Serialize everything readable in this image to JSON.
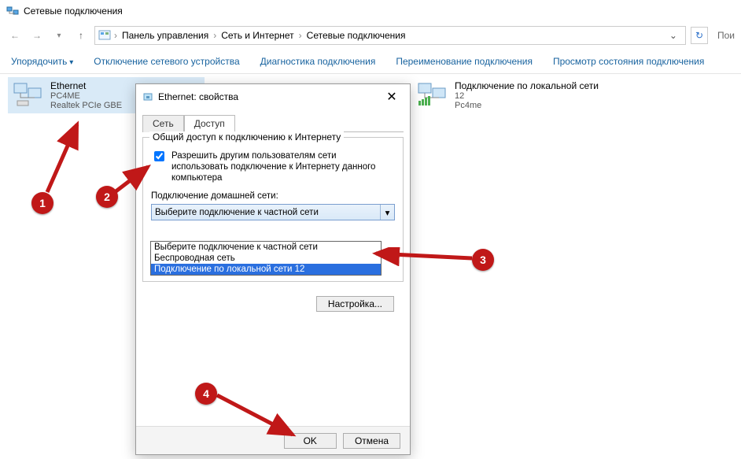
{
  "window_title": "Сетевые подключения",
  "breadcrumbs": {
    "a": "Панель управления",
    "b": "Сеть и Интернет",
    "c": "Сетевые подключения"
  },
  "search_trunc": "Пои",
  "toolbar": {
    "organize": "Упорядочить",
    "disable": "Отключение сетевого устройства",
    "diagnose": "Диагностика подключения",
    "rename": "Переименование подключения",
    "status": "Просмотр состояния подключения"
  },
  "connections": {
    "ethernet": {
      "name": "Ethernet",
      "l2": "PC4ME",
      "l3": "Realtek PCIe GBE"
    },
    "lan": {
      "name": "Подключение по локальной сети",
      "l2": "12",
      "l3": "Pc4me"
    }
  },
  "dialog": {
    "title": "Ethernet: свойства",
    "tab_network": "Сеть",
    "tab_sharing": "Доступ",
    "group_title": "Общий доступ к подключению к Интернету",
    "chk1": "Разрешить другим пользователям сети использовать подключение к Интернету данного компьютера",
    "home_label": "Подключение домашней сети:",
    "combo_value": "Выберите подключение к частной сети",
    "options": {
      "o1": "Выберите подключение к частной сети",
      "o2": "Беспроводная сеть",
      "o3": "Подключение по локальной сети 12"
    },
    "settings_btn": "Настройка...",
    "ok": "OK",
    "cancel": "Отмена"
  },
  "markers": {
    "m1": "1",
    "m2": "2",
    "m3": "3",
    "m4": "4"
  }
}
